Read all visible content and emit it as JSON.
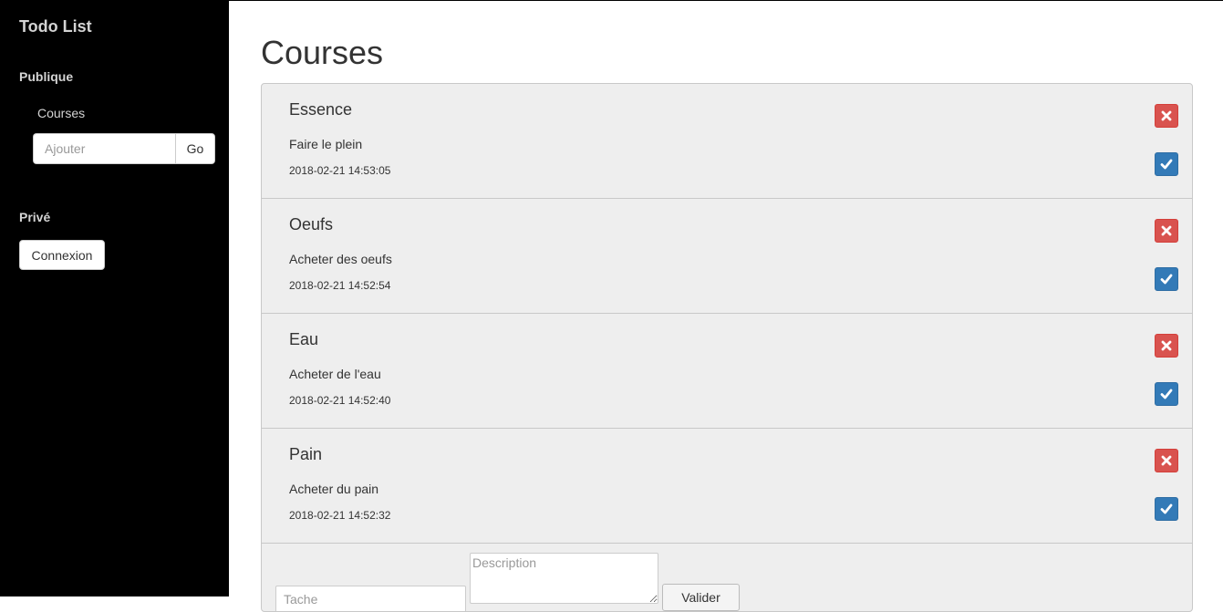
{
  "sidebar": {
    "brand": "Todo List",
    "public_section": {
      "title": "Publique",
      "lists": [
        "Courses"
      ],
      "add_placeholder": "Ajouter",
      "add_button": "Go"
    },
    "private_section": {
      "title": "Privé",
      "login_button": "Connexion"
    }
  },
  "main": {
    "title": "Courses",
    "items": [
      {
        "title": "Essence",
        "description": "Faire le plein",
        "date": "2018-02-21 14:53:05"
      },
      {
        "title": "Oeufs",
        "description": "Acheter des oeufs",
        "date": "2018-02-21 14:52:54"
      },
      {
        "title": "Eau",
        "description": "Acheter de l'eau",
        "date": "2018-02-21 14:52:40"
      },
      {
        "title": "Pain",
        "description": "Acheter du pain",
        "date": "2018-02-21 14:52:32"
      }
    ],
    "form": {
      "task_placeholder": "Tache",
      "description_placeholder": "Description",
      "submit_label": "Valider"
    }
  },
  "icons": {
    "delete": "times-icon",
    "done": "check-icon"
  },
  "colors": {
    "sidebar_bg": "#000000",
    "delete_button": "#d9534f",
    "done_button": "#337ab7",
    "list_bg": "#eeeeee"
  }
}
